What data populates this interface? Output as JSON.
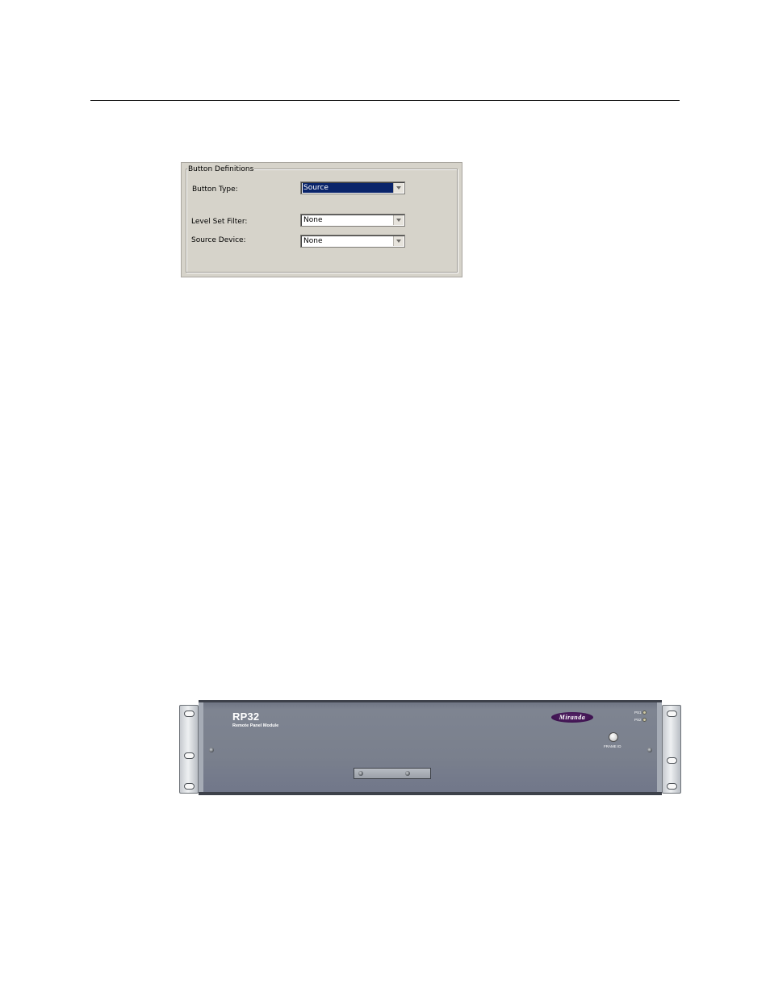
{
  "dialog": {
    "group_title": "Button Definitions",
    "fields": [
      {
        "label": "Button Type:",
        "value": "Source",
        "selected": true
      },
      {
        "label": "Level Set Filter:",
        "value": "None",
        "selected": false
      },
      {
        "label": "Source Device:",
        "value": "None",
        "selected": false
      }
    ]
  },
  "device": {
    "model": "RP32",
    "subtitle": "Remote Panel Module",
    "brand": "Miranda",
    "ps1_label": "PS1",
    "ps2_label": "PS2",
    "frame_id_label": "FRAME ID"
  },
  "colors": {
    "dialog_background": "#d6d3ca",
    "selection_highlight": "#0a246a",
    "panel_face": "#7a808d",
    "brand_badge": "#3e1250"
  }
}
